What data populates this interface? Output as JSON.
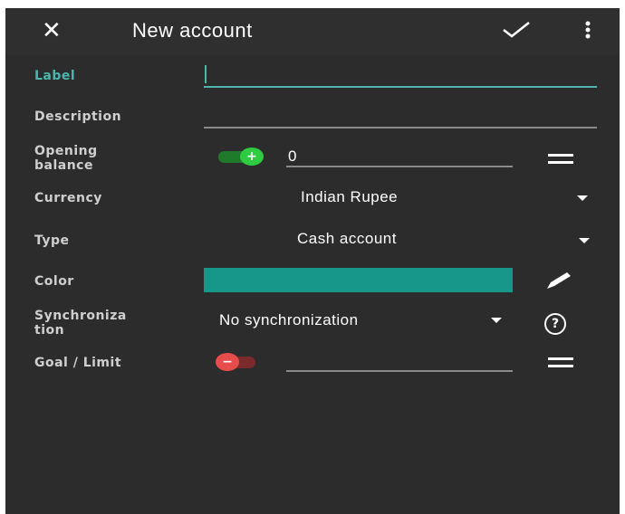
{
  "toolbar": {
    "title": "New account",
    "close_icon": "close-icon",
    "confirm_icon": "checkmark-icon",
    "more_icon": "more-vert-icon"
  },
  "form": {
    "label": {
      "caption": "Label",
      "value": ""
    },
    "description": {
      "caption": "Description",
      "value": ""
    },
    "opening_balance": {
      "caption_line1": "Opening",
      "caption_line2": "balance",
      "sign": "+",
      "value": "0"
    },
    "currency": {
      "caption": "Currency",
      "selected": "Indian Rupee"
    },
    "type": {
      "caption": "Type",
      "selected": "Cash account"
    },
    "color": {
      "caption": "Color",
      "value": "#17968a"
    },
    "synchronization": {
      "caption_line1": "Synchroniza",
      "caption_line2": "tion",
      "selected": "No synchronization"
    },
    "goal_limit": {
      "caption": "Goal / Limit",
      "sign": "−",
      "value": ""
    }
  },
  "colors": {
    "accent": "#4db6ac",
    "background": "#2c2c2c",
    "positive": "#2ecc40",
    "negative": "#e74c4c"
  }
}
